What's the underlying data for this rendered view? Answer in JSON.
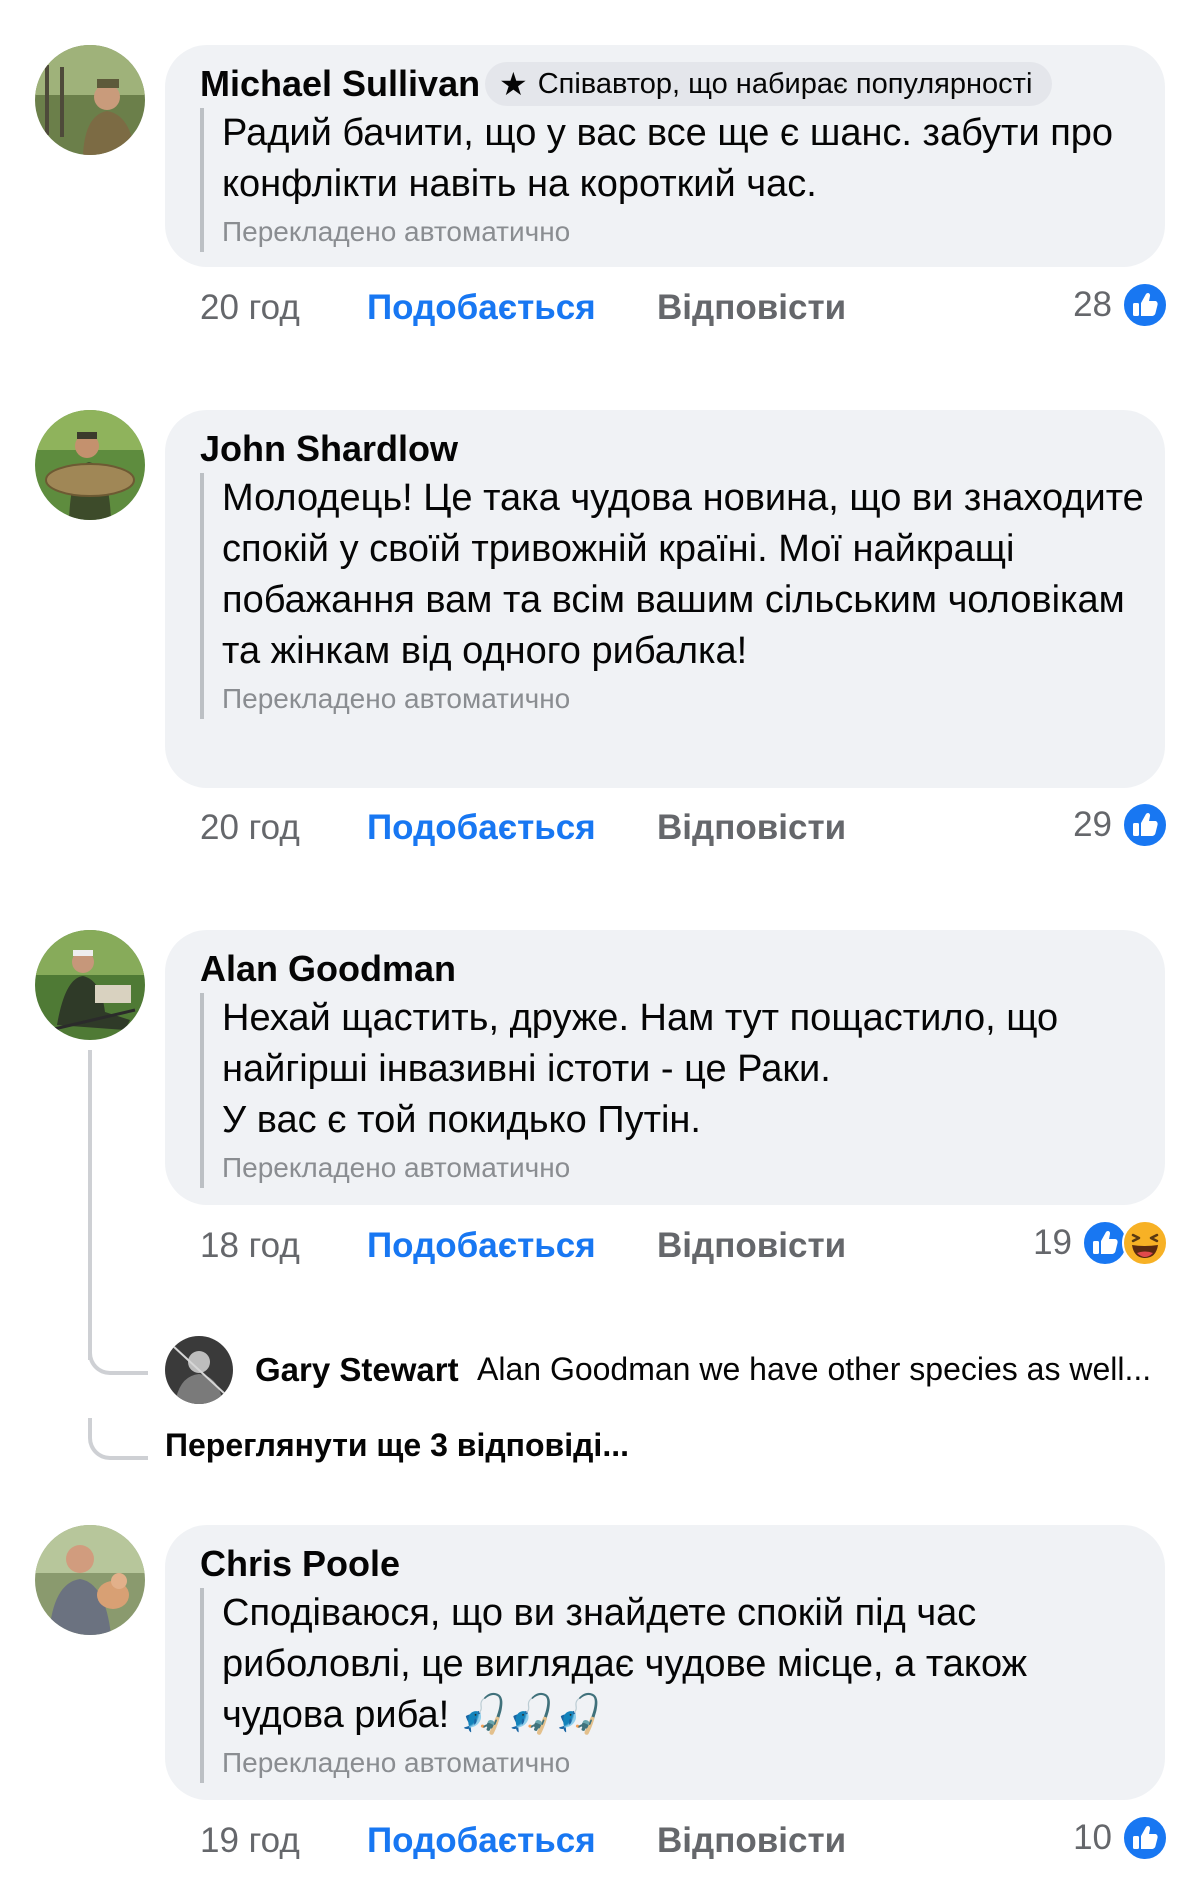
{
  "colors": {
    "like_active": "#1877f2",
    "muted_text": "#65676b",
    "bubble_bg": "#f0f2f5",
    "translated_text": "#8a8d91"
  },
  "comments": [
    {
      "author": "Michael Sullivan",
      "badge": "Співавтор, що набирає популярності",
      "badge_icon": "star-icon",
      "text": "Радий бачити, що у вас все ще є шанс. забути про конфлікти навіть на короткий час.",
      "translated": "Перекладено автоматично",
      "time": "20 год",
      "like_label": "Подобається",
      "reply_label": "Відповісти",
      "reaction_count": "28",
      "reactions": [
        "like-icon"
      ]
    },
    {
      "author": "John Shardlow",
      "text": "Молодець! Це така чудова новина, що ви знаходите спокій у своїй тривожній країні. Мої найкращі побажання вам та всім вашим сільським чоловікам та жінкам від одного рибалка!",
      "translated": "Перекладено автоматично",
      "time": "20 год",
      "like_label": "Подобається",
      "reply_label": "Відповісти",
      "reaction_count": "29",
      "reactions": [
        "like-icon"
      ]
    },
    {
      "author": "Alan Goodman",
      "text_lines": [
        "Нехай щастить, друже. Нам тут пощастило, що найгірші інвазивні істоти - це Раки.",
        "У вас є той покидько Путін."
      ],
      "translated": "Перекладено автоматично",
      "time": "18 год",
      "like_label": "Подобається",
      "reply_label": "Відповісти",
      "reaction_count": "19",
      "reactions": [
        "like-icon",
        "haha-icon"
      ],
      "reply_preview": {
        "author": "Gary Stewart",
        "text": "Alan Goodman we have other species as well..."
      },
      "more_replies": "Переглянути ще 3 відповіді..."
    },
    {
      "author": "Chris Poole",
      "text": "Сподіваюся, що ви знайдете спокій під час риболовлі, це виглядає чудове місце, а також чудова риба!",
      "emoji": "🎣🎣🎣",
      "emoji_icon": "fishing-pole-icon",
      "translated": "Перекладено автоматично",
      "time": "19 год",
      "like_label": "Подобається",
      "reply_label": "Відповісти",
      "reaction_count": "10",
      "reactions": [
        "like-icon"
      ]
    }
  ]
}
